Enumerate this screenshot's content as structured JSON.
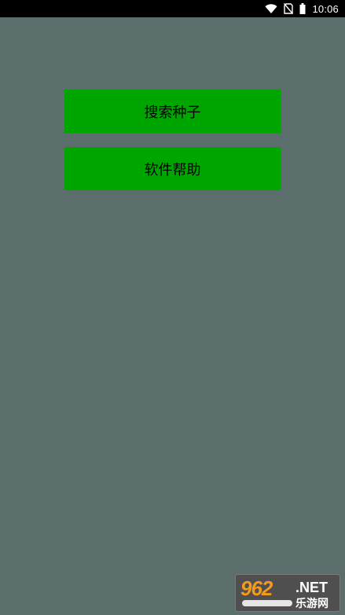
{
  "status_bar": {
    "time": "10:06",
    "icons": [
      "wifi-icon",
      "no-sim-icon",
      "battery-icon"
    ]
  },
  "menu": {
    "buttons": [
      {
        "label": "搜索种子"
      },
      {
        "label": "软件帮助"
      }
    ]
  },
  "watermark": {
    "logo_text": "962",
    "suffix": ".NET",
    "site_name": "乐游网"
  },
  "colors": {
    "background": "#5b6e6c",
    "button": "#00a600",
    "status_bar": "#000000"
  }
}
